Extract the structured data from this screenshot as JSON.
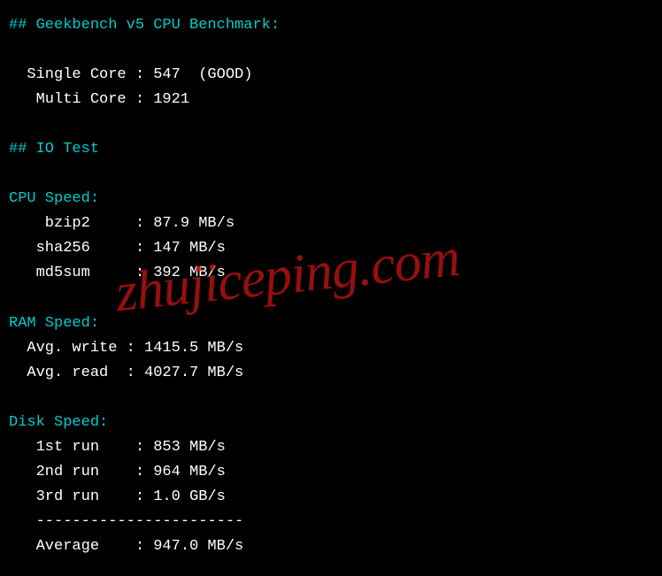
{
  "watermark": "zhujiceping.com",
  "geekbench": {
    "header": "## Geekbench v5 CPU Benchmark:",
    "single_core_line": "  Single Core : 547  (GOOD)",
    "multi_core_line": "   Multi Core : 1921"
  },
  "io_test": {
    "header": "## IO Test"
  },
  "cpu_speed": {
    "header": "CPU Speed:",
    "bzip2_line": "    bzip2     : 87.9 MB/s",
    "sha256_line": "   sha256     : 147 MB/s",
    "md5sum_line": "   md5sum     : 392 MB/s"
  },
  "ram_speed": {
    "header": "RAM Speed:",
    "write_line": "  Avg. write : 1415.5 MB/s",
    "read_line": "  Avg. read  : 4027.7 MB/s"
  },
  "disk_speed": {
    "header": "Disk Speed:",
    "run1_line": "   1st run    : 853 MB/s",
    "run2_line": "   2nd run    : 964 MB/s",
    "run3_line": "   3rd run    : 1.0 GB/s",
    "divider_line": "   -----------------------",
    "average_line": "   Average    : 947.0 MB/s"
  },
  "chart_data": {
    "type": "table",
    "title": "Server Benchmark Results",
    "sections": [
      {
        "name": "Geekbench v5 CPU Benchmark",
        "rows": [
          {
            "label": "Single Core",
            "value": 547,
            "note": "GOOD"
          },
          {
            "label": "Multi Core",
            "value": 1921
          }
        ]
      },
      {
        "name": "CPU Speed",
        "rows": [
          {
            "label": "bzip2",
            "value": 87.9,
            "unit": "MB/s"
          },
          {
            "label": "sha256",
            "value": 147,
            "unit": "MB/s"
          },
          {
            "label": "md5sum",
            "value": 392,
            "unit": "MB/s"
          }
        ]
      },
      {
        "name": "RAM Speed",
        "rows": [
          {
            "label": "Avg. write",
            "value": 1415.5,
            "unit": "MB/s"
          },
          {
            "label": "Avg. read",
            "value": 4027.7,
            "unit": "MB/s"
          }
        ]
      },
      {
        "name": "Disk Speed",
        "rows": [
          {
            "label": "1st run",
            "value": 853,
            "unit": "MB/s"
          },
          {
            "label": "2nd run",
            "value": 964,
            "unit": "MB/s"
          },
          {
            "label": "3rd run",
            "value": 1.0,
            "unit": "GB/s"
          },
          {
            "label": "Average",
            "value": 947.0,
            "unit": "MB/s"
          }
        ]
      }
    ]
  }
}
